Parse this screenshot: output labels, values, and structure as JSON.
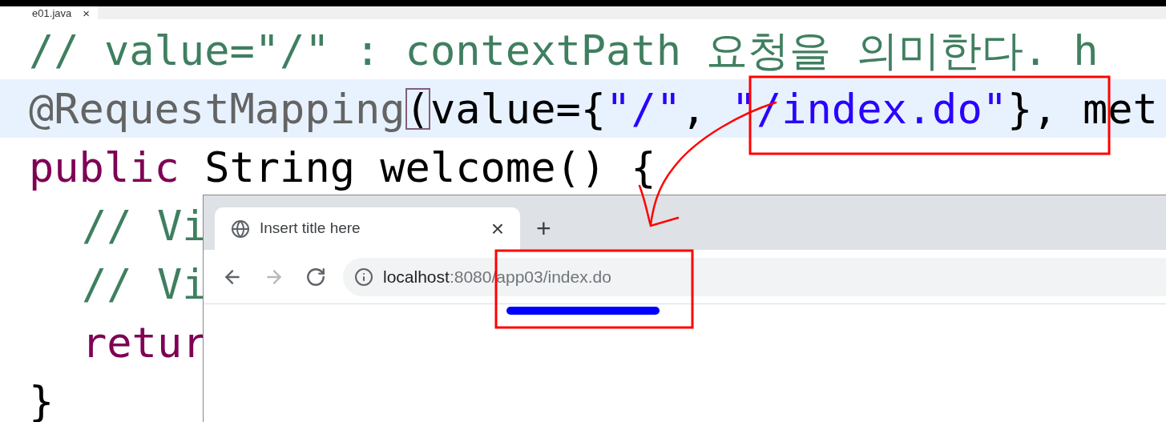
{
  "editor": {
    "tab": {
      "label": "e01.java",
      "close": "×"
    },
    "lines": [
      {
        "highlighted": false,
        "indent": false,
        "tokens": [
          {
            "kind": "comment",
            "text": "// value=\"/\" : contextPath 요청을 의미한다. h"
          }
        ]
      },
      {
        "highlighted": true,
        "indent": false,
        "tokens": [
          {
            "kind": "annotation",
            "text": "@RequestMapping"
          },
          {
            "kind": "bracket",
            "text": "("
          },
          {
            "kind": "plain",
            "text": "value={"
          },
          {
            "kind": "string",
            "text": "\"/\""
          },
          {
            "kind": "plain",
            "text": ", "
          },
          {
            "kind": "string",
            "text": "\"/index.do\""
          },
          {
            "kind": "plain",
            "text": "}, met"
          }
        ]
      },
      {
        "highlighted": false,
        "indent": false,
        "tokens": [
          {
            "kind": "keyword",
            "text": "public"
          },
          {
            "kind": "plain",
            "text": " String welcome() {"
          }
        ]
      },
      {
        "highlighted": false,
        "indent": true,
        "tokens": [
          {
            "kind": "comment",
            "text": "// Vi"
          }
        ]
      },
      {
        "highlighted": false,
        "indent": true,
        "tokens": [
          {
            "kind": "comment",
            "text": "// Vi"
          }
        ]
      },
      {
        "highlighted": false,
        "indent": true,
        "tokens": [
          {
            "kind": "keyword",
            "text": "retur"
          }
        ]
      },
      {
        "highlighted": false,
        "indent": false,
        "tokens": [
          {
            "kind": "plain",
            "text": "}"
          }
        ]
      }
    ]
  },
  "browser": {
    "tab": {
      "title": "Insert title here",
      "close": "×",
      "selected": true
    },
    "new_tab": "+",
    "nav": [
      {
        "kind": "back",
        "disabled": false
      },
      {
        "kind": "forward",
        "disabled": true
      },
      {
        "kind": "reload",
        "disabled": false
      }
    ],
    "address": {
      "host": "localhost",
      "rest": ":8080/app03/index.do"
    }
  }
}
